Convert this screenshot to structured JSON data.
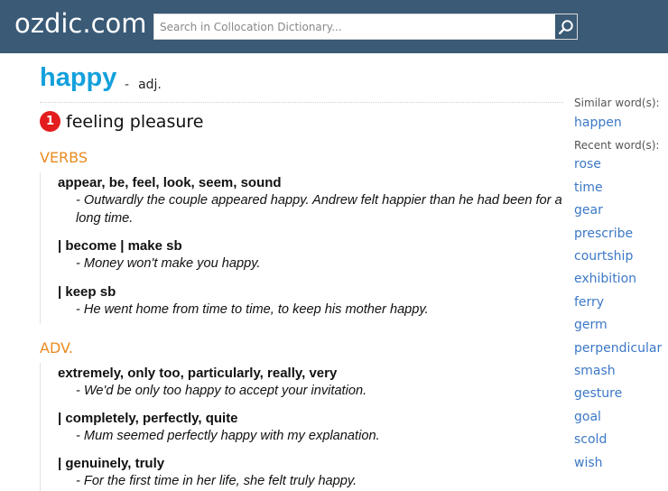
{
  "site": {
    "logo": "ozdic.com"
  },
  "search": {
    "placeholder": "Search in Collocation Dictionary..."
  },
  "entry": {
    "headword": "happy",
    "dash": "-",
    "pos": "adj."
  },
  "sense": {
    "number": "1",
    "text": "feeling pleasure"
  },
  "sections": [
    {
      "label": "VERBS",
      "items": [
        {
          "collocation": "appear, be, feel, look, seem, sound",
          "example": "- Outwardly the couple appeared happy. Andrew felt happier than he had been for a long time."
        },
        {
          "collocation": "| become | make sb",
          "example": "- Money won't make you happy."
        },
        {
          "collocation": "| keep sb",
          "example": "- He went home from time to time, to keep his mother happy."
        }
      ]
    },
    {
      "label": "ADV.",
      "items": [
        {
          "collocation": "extremely, only too, particularly, really, very",
          "example": "- We'd be only too happy to accept your invitation."
        },
        {
          "collocation": "| completely, perfectly, quite",
          "example": "- Mum seemed perfectly happy with my explanation."
        },
        {
          "collocation": "| genuinely, truly",
          "example": "- For the first time in her life, she felt truly happy."
        }
      ]
    }
  ],
  "sidebar": {
    "similar_heading": "Similar word(s):",
    "similar": [
      "happen"
    ],
    "recent_heading": "Recent word(s):",
    "recent": [
      "rose",
      "time",
      "gear",
      "prescribe",
      "courtship",
      "exhibition",
      "ferry",
      "germ",
      "perpendicular",
      "smash",
      "gesture",
      "goal",
      "scold",
      "wish"
    ]
  },
  "colors": {
    "header_bg": "#3a5a76",
    "headword": "#14a0dc",
    "section_label": "#e98a1f",
    "sense_badge": "#e31d1d",
    "link": "#3c78c6"
  },
  "icons": {
    "search": "search-icon"
  }
}
